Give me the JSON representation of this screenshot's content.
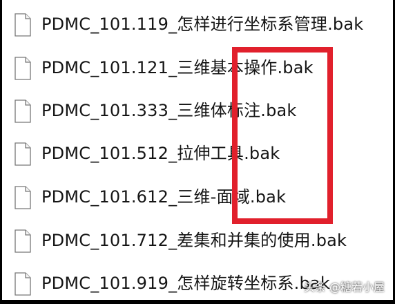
{
  "explorer": {
    "files": [
      {
        "name": "PDMC_101.119_怎样进行坐标系管理.bak",
        "icon": "blank-file-icon"
      },
      {
        "name": "PDMC_101.121_三维基本操作.bak",
        "icon": "blank-file-icon"
      },
      {
        "name": "PDMC_101.333_三维体标注.bak",
        "icon": "blank-file-icon"
      },
      {
        "name": "PDMC_101.512_拉伸工具.bak",
        "icon": "blank-file-icon"
      },
      {
        "name": "PDMC_101.612_三维-面域.bak",
        "icon": "blank-file-icon"
      },
      {
        "name": "PDMC_101.712_差集和并集的使用.bak",
        "icon": "blank-file-icon"
      },
      {
        "name": "PDMC_101.919_怎样旋转坐标系.bak",
        "icon": "blank-file-icon"
      }
    ]
  },
  "watermark": {
    "text": "头条 @糖若小屋"
  },
  "colors": {
    "highlight": "#e1202c",
    "text": "#151515",
    "background": "#ffffff",
    "outer_border": "#000000"
  }
}
